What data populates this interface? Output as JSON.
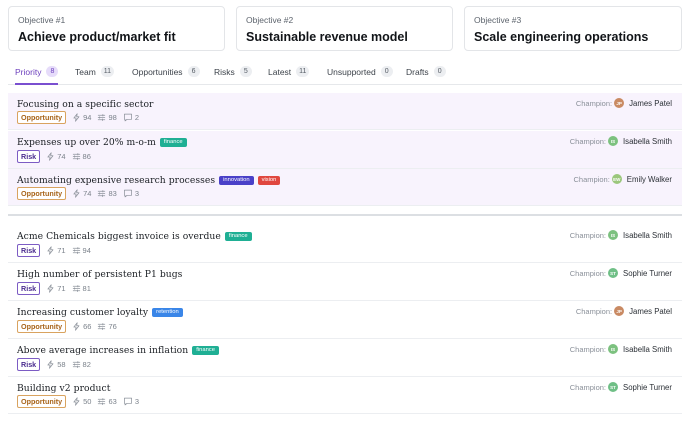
{
  "objectives": [
    {
      "num": "Objective #1",
      "title": "Achieve product/market fit"
    },
    {
      "num": "Objective #2",
      "title": "Sustainable revenue model"
    },
    {
      "num": "Objective #3",
      "title": "Scale engineering operations"
    }
  ],
  "tabs": [
    {
      "label": "Priority",
      "count": "8",
      "active": true
    },
    {
      "label": "Team",
      "count": "11"
    },
    {
      "label": "Opportunities",
      "count": "6"
    },
    {
      "label": "Risks",
      "count": "5"
    },
    {
      "label": "Latest",
      "count": "11"
    },
    {
      "label": "Unsupported",
      "count": "0"
    },
    {
      "label": "Drafts",
      "count": "0"
    }
  ],
  "champion_label": "Champion:",
  "colors": {
    "accent": "#7a4fd0",
    "tag_finance": "#1faf94",
    "tag_innovation": "#4a40c8",
    "tag_vision": "#e0473f",
    "tag_retention": "#3a86e8",
    "avatar_jp": "#c98a63",
    "avatar_is": "#7cc17f",
    "avatar_ew": "#9bc77c",
    "avatar_st": "#6fbf86"
  },
  "items": [
    {
      "title": "Focusing on a specific sector",
      "tags": [],
      "type": "Opportunity",
      "bolt": "94",
      "sliders": "98",
      "comments": "2",
      "champion": "James Patel",
      "initials": "JP",
      "avatar_color": "#c98a63"
    },
    {
      "title": "Expenses up over 20% m-o-m",
      "tags": [
        {
          "label": "finance",
          "color": "#1faf94"
        }
      ],
      "type": "Risk",
      "bolt": "74",
      "sliders": "86",
      "comments": "",
      "champion": "Isabella Smith",
      "initials": "IS",
      "avatar_color": "#7cc17f"
    },
    {
      "title": "Automating expensive research processes",
      "tags": [
        {
          "label": "innovation",
          "color": "#4a40c8"
        },
        {
          "label": "vision",
          "color": "#e0473f"
        }
      ],
      "type": "Opportunity",
      "bolt": "74",
      "sliders": "83",
      "comments": "3",
      "champion": "Emily Walker",
      "initials": "EW",
      "avatar_color": "#9bc77c"
    },
    {
      "title": "Acme Chemicals biggest invoice is overdue",
      "tags": [
        {
          "label": "finance",
          "color": "#1faf94"
        }
      ],
      "type": "Risk",
      "bolt": "71",
      "sliders": "94",
      "comments": "",
      "champion": "Isabella Smith",
      "initials": "IS",
      "avatar_color": "#7cc17f"
    },
    {
      "title": "High number of persistent P1 bugs",
      "tags": [],
      "type": "Risk",
      "bolt": "71",
      "sliders": "81",
      "comments": "",
      "champion": "Sophie Turner",
      "initials": "ST",
      "avatar_color": "#6fbf86"
    },
    {
      "title": "Increasing customer loyalty",
      "tags": [
        {
          "label": "retention",
          "color": "#3a86e8"
        }
      ],
      "type": "Opportunity",
      "bolt": "66",
      "sliders": "76",
      "comments": "",
      "champion": "James Patel",
      "initials": "JP",
      "avatar_color": "#c98a63"
    },
    {
      "title": "Above average increases in inflation",
      "tags": [
        {
          "label": "finance",
          "color": "#1faf94"
        }
      ],
      "type": "Risk",
      "bolt": "58",
      "sliders": "82",
      "comments": "",
      "champion": "Isabella Smith",
      "initials": "IS",
      "avatar_color": "#7cc17f"
    },
    {
      "title": "Building v2 product",
      "tags": [],
      "type": "Opportunity",
      "bolt": "50",
      "sliders": "63",
      "comments": "3",
      "champion": "Sophie Turner",
      "initials": "ST",
      "avatar_color": "#6fbf86"
    }
  ]
}
